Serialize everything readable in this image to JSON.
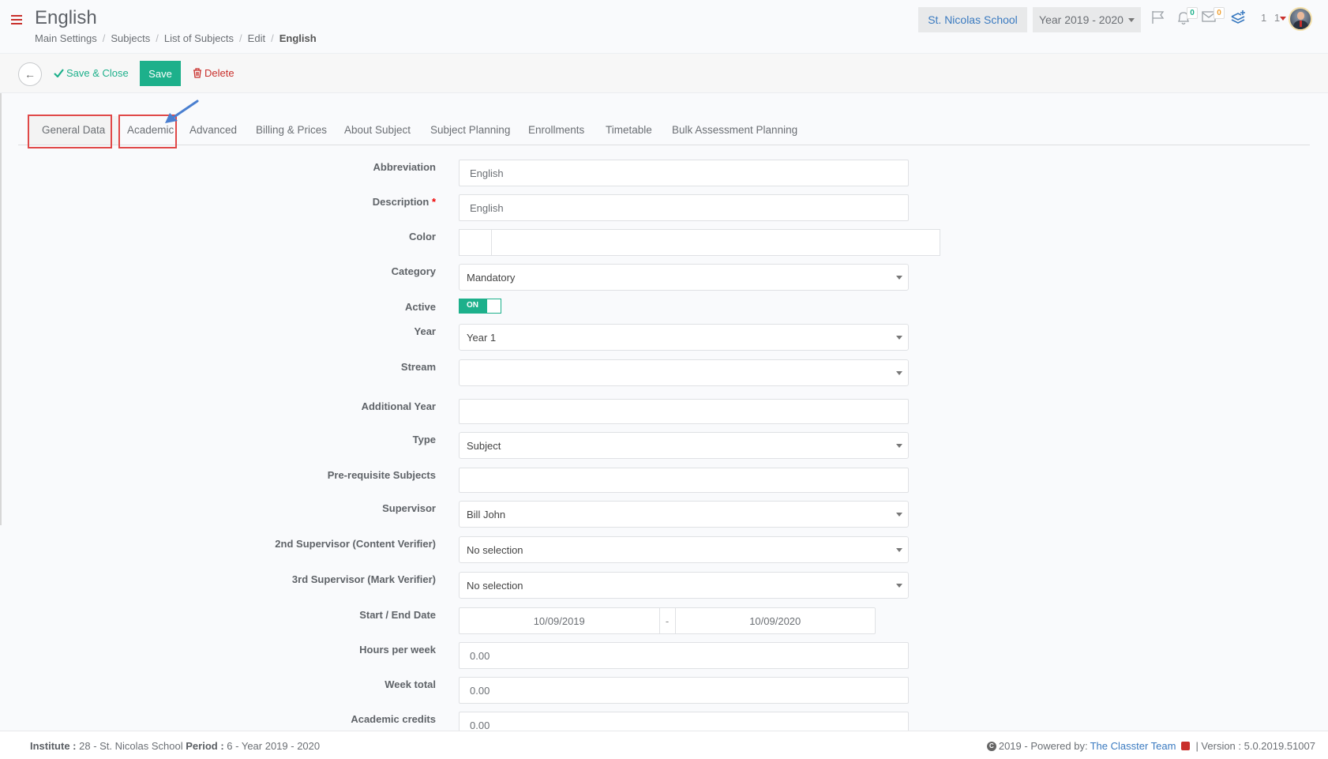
{
  "header": {
    "title": "English",
    "breadcrumb": [
      "Main Settings",
      "Subjects",
      "List of Subjects",
      "Edit"
    ],
    "breadcrumb_current": "English",
    "school_button": "St. Nicolas School",
    "year_selector": "Year 2019 - 2020",
    "notifications_count": "0",
    "messages_count": "0",
    "user_number": "1 1"
  },
  "toolbar": {
    "save_close_label": "Save & Close",
    "save_label": "Save",
    "delete_label": "Delete"
  },
  "tabs": [
    {
      "label": "General Data",
      "active": true,
      "highlighted": true
    },
    {
      "label": "Academic",
      "active": false,
      "highlighted": true
    },
    {
      "label": "Advanced",
      "active": false
    },
    {
      "label": "Billing & Prices",
      "active": false
    },
    {
      "label": "About Subject",
      "active": false
    },
    {
      "label": "Subject Planning",
      "active": false
    },
    {
      "label": "Enrollments",
      "active": false
    },
    {
      "label": "Timetable",
      "active": false
    },
    {
      "label": "Bulk Assessment Planning",
      "active": false
    }
  ],
  "form": {
    "abbreviation": {
      "label": "Abbreviation",
      "value": "English"
    },
    "description": {
      "label": "Description",
      "required_mark": "*",
      "value": "English"
    },
    "color": {
      "label": "Color",
      "value": ""
    },
    "category": {
      "label": "Category",
      "value": "Mandatory"
    },
    "active": {
      "label": "Active",
      "value": "ON"
    },
    "year": {
      "label": "Year",
      "value": "Year 1"
    },
    "stream": {
      "label": "Stream",
      "value": ""
    },
    "additional_year": {
      "label": "Additional Year",
      "value": ""
    },
    "type": {
      "label": "Type",
      "value": "Subject"
    },
    "prerequisite_subjects": {
      "label": "Pre-requisite Subjects",
      "value": ""
    },
    "supervisor": {
      "label": "Supervisor",
      "value": "Bill John"
    },
    "second_supervisor": {
      "label": "2nd Supervisor (Content Verifier)",
      "value": "No selection"
    },
    "third_supervisor": {
      "label": "3rd Supervisor (Mark Verifier)",
      "value": "No selection"
    },
    "start_end_date": {
      "label": "Start / End Date",
      "start": "10/09/2019",
      "separator": "-",
      "end": "10/09/2020"
    },
    "hours_per_week": {
      "label": "Hours per week",
      "value": "0.00"
    },
    "week_total": {
      "label": "Week total",
      "value": "0.00"
    },
    "academic_credits": {
      "label": "Academic credits",
      "value": "0.00"
    }
  },
  "footer": {
    "institute_label": "Institute :",
    "institute_value": "28 - St. Nicolas School",
    "period_label": "Period :",
    "period_value": "6 - Year 2019 - 2020",
    "copyright": "2019 - Powered by:",
    "powered_by_link": "The Classter Team",
    "version": "| Version : 5.0.2019.51007"
  }
}
